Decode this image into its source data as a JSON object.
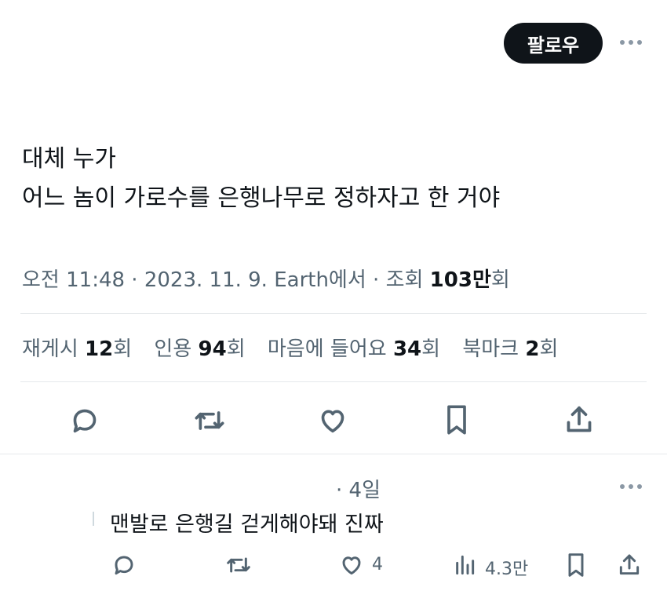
{
  "header": {
    "follow_label": "팔로우"
  },
  "tweet": {
    "lines": [
      "대체 누가",
      "어느 놈이 가로수를 은행나무로 정하자고 한 거야"
    ],
    "meta_prefix": "오전 11:48 · 2023. 11. 9. Earth에서 · 조회 ",
    "views": "103만",
    "views_suffix": "회"
  },
  "stats": {
    "retweets_label": "재게시 ",
    "retweets_count": "12",
    "retweets_unit": "회",
    "quotes_label": "인용 ",
    "quotes_count": "94",
    "quotes_unit": "회",
    "likes_label": "마음에 들어요 ",
    "likes_count": "34",
    "likes_unit": "회",
    "bookmarks_label": "북마크 ",
    "bookmarks_count": "2",
    "bookmarks_unit": "회"
  },
  "actions": [
    "reply-icon",
    "retweet-icon",
    "heart-icon",
    "bookmark-icon",
    "share-icon"
  ],
  "reply": {
    "time": "· 4일",
    "text": "맨발로 은행길 걷게해야돼 진짜",
    "likes": "4",
    "views": "4.3만"
  },
  "colors": {
    "text": "#0f1419",
    "muted": "#536471",
    "divider": "#e6e9ec"
  }
}
